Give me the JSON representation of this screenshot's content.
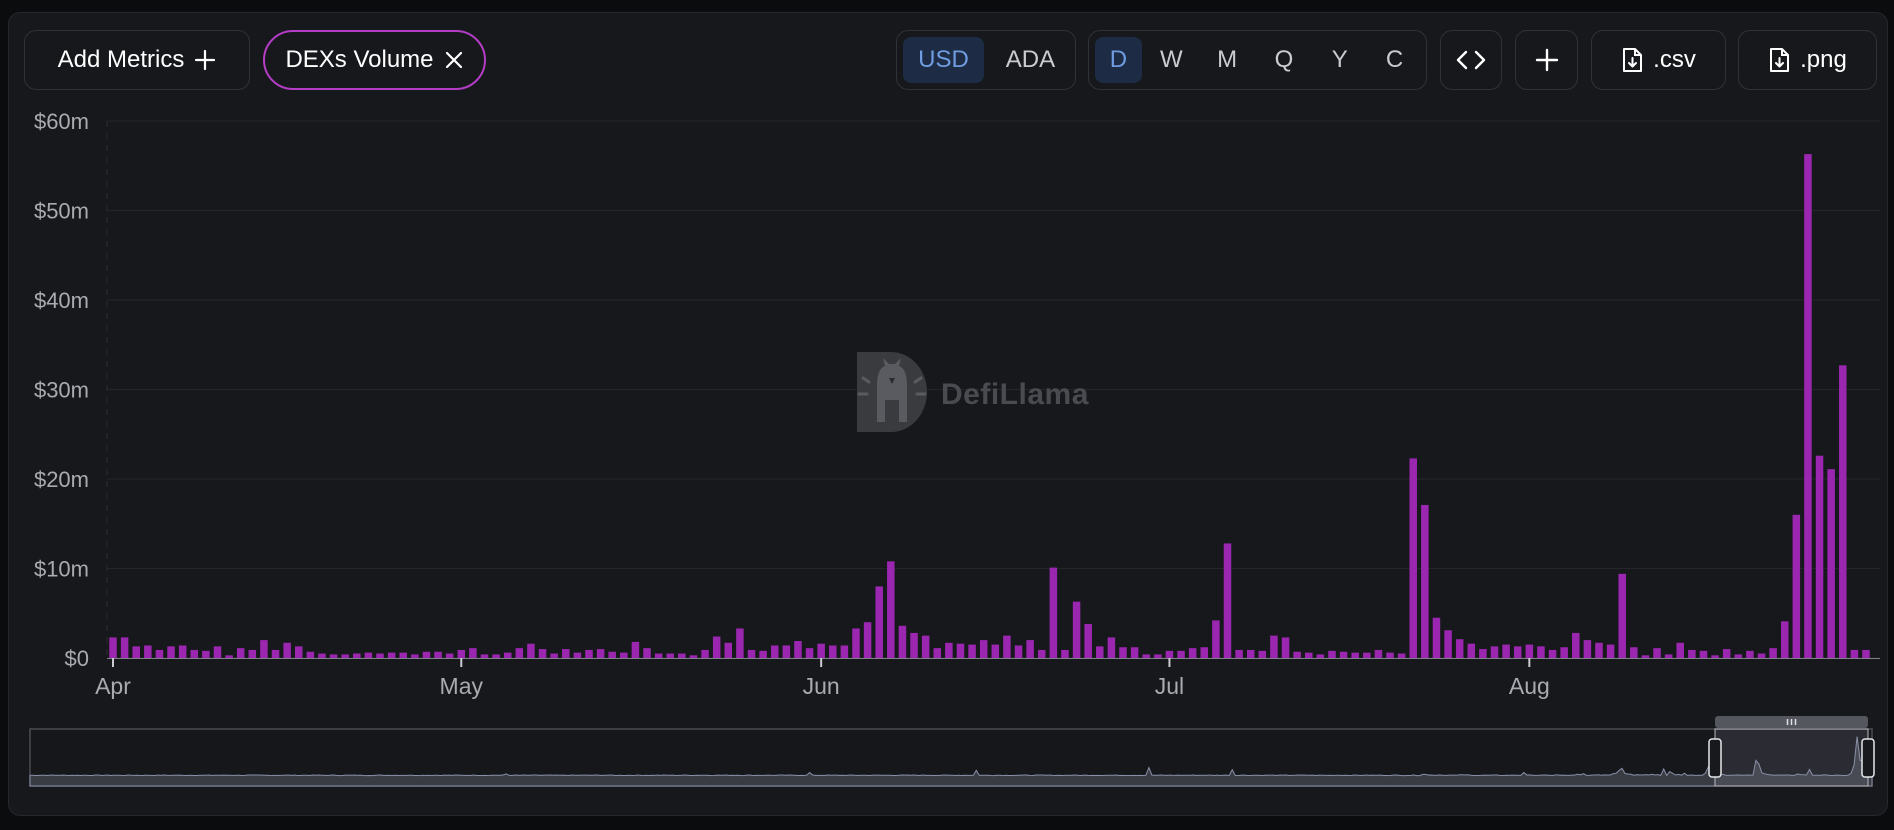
{
  "toolbar": {
    "add_metrics_label": "Add Metrics",
    "active_metric_label": "DEXs Volume",
    "currency_options": [
      "USD",
      "ADA"
    ],
    "currency_selected": "USD",
    "interval_options": [
      "D",
      "W",
      "M",
      "Q",
      "Y",
      "C"
    ],
    "interval_selected": "D",
    "csv_label": ".csv",
    "png_label": ".png",
    "icons": [
      "plus-icon",
      "close-icon",
      "code-icon",
      "add-icon",
      "file-download-icon"
    ]
  },
  "watermark": {
    "text": "DefiLlama"
  },
  "colors": {
    "bar": "#9b27b0",
    "accent_border": "#b43dc5",
    "selected_bg": "#1d2b44",
    "selected_text": "#6f9be0"
  },
  "chart_data": {
    "type": "bar",
    "title": "",
    "xlabel": "",
    "ylabel": "",
    "ylim": [
      0,
      60
    ],
    "y_unit": "$m",
    "y_ticks": [
      "$0",
      "$10m",
      "$20m",
      "$30m",
      "$40m",
      "$50m",
      "$60m"
    ],
    "x_ticks": [
      "Apr",
      "May",
      "Jun",
      "Jul",
      "Aug"
    ],
    "grid": true,
    "series": [
      {
        "values": [
          2.3,
          2.3,
          1.3,
          1.4,
          0.9,
          1.3,
          1.4,
          0.9,
          0.8,
          1.3,
          0.3,
          1.1,
          0.9,
          2.0,
          0.9,
          1.7,
          1.3,
          0.7,
          0.5,
          0.4,
          0.4,
          0.5,
          0.6,
          0.5,
          0.6,
          0.6,
          0.4,
          0.7,
          0.7,
          0.5,
          0.9,
          1.1,
          0.4,
          0.4,
          0.6,
          1.1,
          1.6,
          1.0,
          0.5,
          1.0,
          0.6,
          0.9,
          1.0,
          0.7,
          0.6,
          1.8,
          1.1,
          0.5,
          0.5,
          0.5,
          0.3,
          0.9,
          2.4,
          1.7,
          3.3,
          0.9,
          0.8,
          1.4,
          1.4,
          1.9,
          1.1,
          1.6,
          1.4,
          1.4,
          3.3,
          4.0,
          8.0,
          10.8,
          3.6,
          2.8,
          2.5,
          1.1,
          1.7,
          1.6,
          1.5,
          2.0,
          1.5,
          2.5,
          1.4,
          2.0,
          0.9,
          10.1,
          0.9,
          6.3,
          3.8,
          1.3,
          2.3,
          1.2,
          1.2,
          0.4,
          0.4,
          0.8,
          0.8,
          1.1,
          1.2,
          4.2,
          12.8,
          0.9,
          0.9,
          0.8,
          2.5,
          2.3,
          0.7,
          0.6,
          0.4,
          0.8,
          0.7,
          0.6,
          0.6,
          0.9,
          0.6,
          0.5,
          22.3,
          17.1,
          4.5,
          3.1,
          2.1,
          1.6,
          1.0,
          1.3,
          1.5,
          1.3,
          1.5,
          1.3,
          0.9,
          1.2,
          2.8,
          2.0,
          1.7,
          1.5,
          9.4,
          1.2,
          0.3,
          1.1,
          0.4,
          1.7,
          0.9,
          0.8,
          0.3,
          1.0,
          0.4,
          0.8,
          0.5,
          1.1,
          4.1,
          16.0,
          56.3,
          22.6,
          21.1,
          32.7,
          0.9,
          0.9
        ]
      }
    ]
  }
}
